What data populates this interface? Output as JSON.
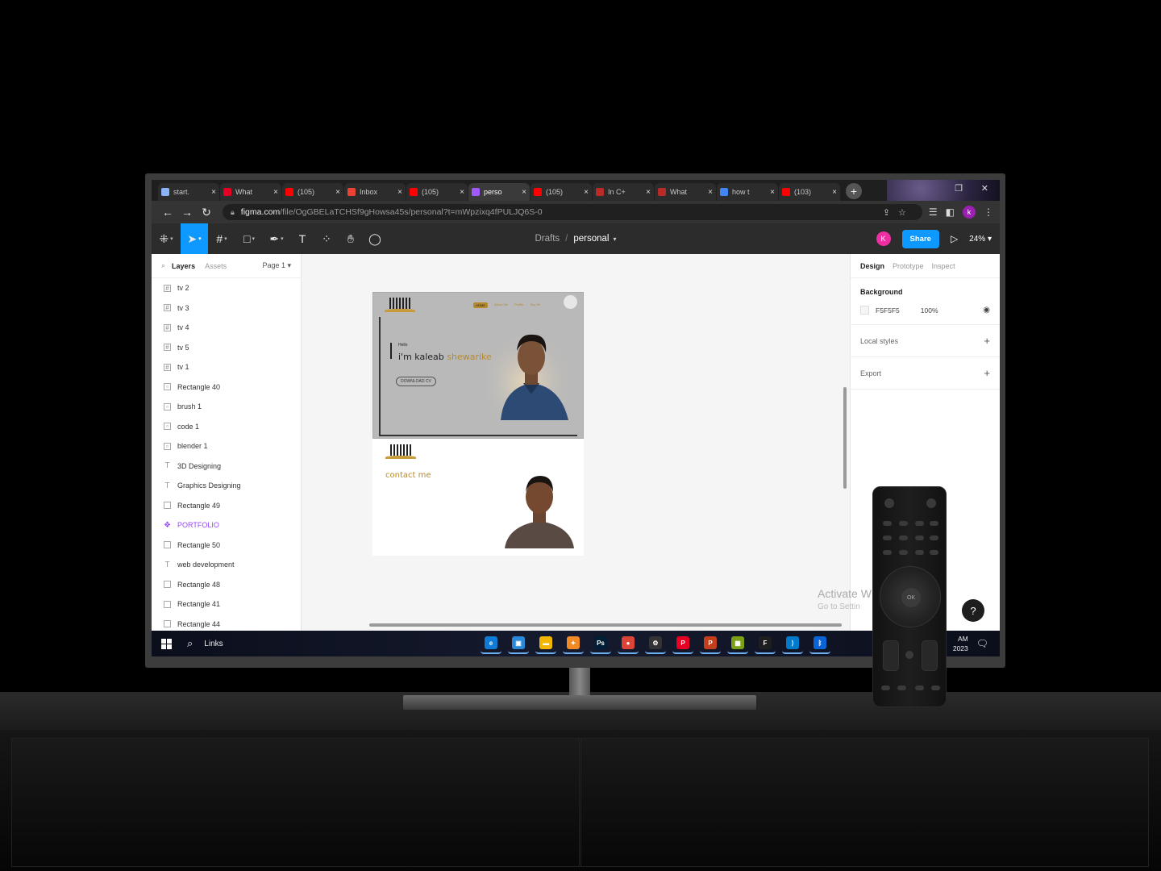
{
  "browser": {
    "tabs": [
      {
        "label": "start.",
        "color": "#8ab4f8",
        "active": false
      },
      {
        "label": "What",
        "color": "#e60023",
        "active": false
      },
      {
        "label": "(105)",
        "color": "#ff0000",
        "active": false
      },
      {
        "label": "Inbox",
        "color": "#ea4335",
        "active": false
      },
      {
        "label": "(105)",
        "color": "#ff0000",
        "active": false
      },
      {
        "label": "perso",
        "color": "#a259ff",
        "active": true
      },
      {
        "label": "(105)",
        "color": "#ff0000",
        "active": false
      },
      {
        "label": "In C+",
        "color": "#b92b27",
        "active": false
      },
      {
        "label": "What",
        "color": "#b92b27",
        "active": false
      },
      {
        "label": "how t",
        "color": "#4285f4",
        "active": false
      },
      {
        "label": "(103)",
        "color": "#ff0000",
        "active": false
      }
    ],
    "tab_close": "×",
    "new_tab": "+",
    "url_host": "figma.com",
    "url_path": "/file/OgGBELaTCHSf9gHowsa45s/personal?t=mWpzixq4fPULJQ6S-0",
    "profile_initial": "k"
  },
  "figma": {
    "breadcrumb_root": "Drafts",
    "breadcrumb_sep": "/",
    "file_name": "personal",
    "collaborator_initial": "K",
    "share_label": "Share",
    "zoom": "24%",
    "left_tabs": {
      "layers": "Layers",
      "assets": "Assets",
      "page": "Page 1"
    },
    "layers": [
      {
        "name": "tv 2",
        "kind": "frame"
      },
      {
        "name": "tv 3",
        "kind": "frame"
      },
      {
        "name": "tv 4",
        "kind": "frame"
      },
      {
        "name": "tv 5",
        "kind": "frame"
      },
      {
        "name": "tv 1",
        "kind": "frame"
      },
      {
        "name": "Rectangle 40",
        "kind": "image"
      },
      {
        "name": "brush 1",
        "kind": "image"
      },
      {
        "name": "code 1",
        "kind": "image"
      },
      {
        "name": "blender 1",
        "kind": "image"
      },
      {
        "name": "3D Designing",
        "kind": "text"
      },
      {
        "name": "Graphics Designing",
        "kind": "text"
      },
      {
        "name": "Rectangle 49",
        "kind": "rect"
      },
      {
        "name": "PORTFOLIO",
        "kind": "component"
      },
      {
        "name": "Rectangle 50",
        "kind": "rect"
      },
      {
        "name": "web development",
        "kind": "text"
      },
      {
        "name": "Rectangle 48",
        "kind": "rect"
      },
      {
        "name": "Rectangle 41",
        "kind": "rect"
      },
      {
        "name": "Rectangle 44",
        "kind": "rect"
      }
    ],
    "right_tabs": {
      "design": "Design",
      "prototype": "Prototype",
      "inspect": "Inspect"
    },
    "background_title": "Background",
    "background_hex": "F5F5F5",
    "background_opacity": "100%",
    "local_styles": "Local styles",
    "export": "Export",
    "design_frame": {
      "nav": [
        "HOME",
        "About Me",
        "Profile",
        "Say Hi!"
      ],
      "hello": "Hello",
      "name_first": "i'm kaleab",
      "name_last": "shewarike",
      "download": "DOWNLOAD CV",
      "contact": "contact me"
    },
    "activate_line1": "Activate W",
    "activate_line2": "Go to Settin",
    "help": "?"
  },
  "taskbar": {
    "search_label": "Links",
    "time": "AM",
    "date": "2023",
    "apps": [
      {
        "name": "edge",
        "glyph": "e",
        "bg": "#0f7bd6"
      },
      {
        "name": "store",
        "glyph": "▣",
        "bg": "#2b88d8"
      },
      {
        "name": "explorer",
        "glyph": "▬",
        "bg": "#f2b600"
      },
      {
        "name": "app-orange",
        "glyph": "✦",
        "bg": "#f08a24"
      },
      {
        "name": "photoshop",
        "glyph": "Ps",
        "bg": "#001e36"
      },
      {
        "name": "chrome",
        "glyph": "●",
        "bg": "#db4437"
      },
      {
        "name": "settings",
        "glyph": "⚙",
        "bg": "#333"
      },
      {
        "name": "pinterest",
        "glyph": "P",
        "bg": "#e60023"
      },
      {
        "name": "powerpoint",
        "glyph": "P",
        "bg": "#c43e1c"
      },
      {
        "name": "office",
        "glyph": "▦",
        "bg": "#7aa116"
      },
      {
        "name": "figma",
        "glyph": "F",
        "bg": "#1e1e1e"
      },
      {
        "name": "vscode",
        "glyph": "⟩",
        "bg": "#007acc"
      },
      {
        "name": "bluetooth",
        "glyph": "ᛒ",
        "bg": "#0a64d8"
      }
    ]
  }
}
